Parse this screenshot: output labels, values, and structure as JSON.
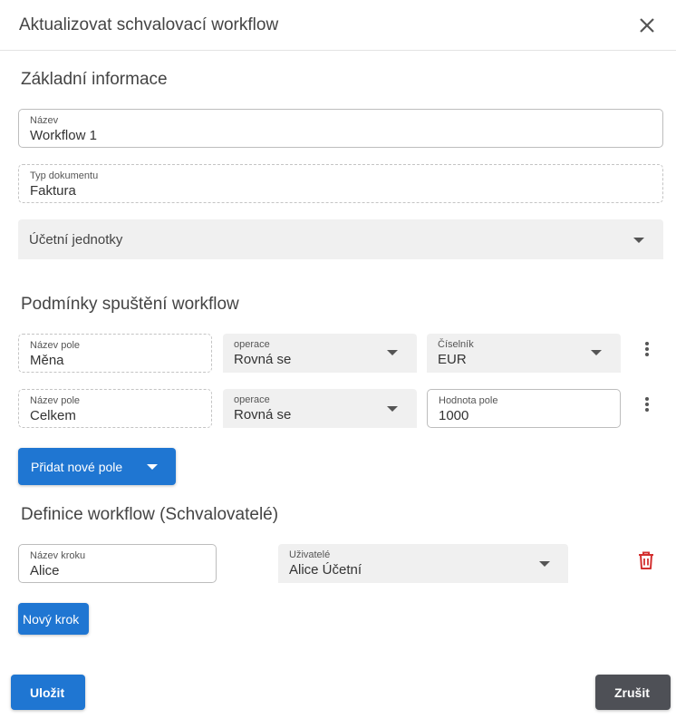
{
  "dialog": {
    "title": "Aktualizovat schvalovací workflow"
  },
  "basic_info": {
    "heading": "Základní informace",
    "name_label": "Název",
    "name_value": "Workflow 1",
    "doc_type_label": "Typ dokumentu",
    "doc_type_value": "Faktura",
    "units_placeholder": "Účetní jednotky"
  },
  "conditions": {
    "heading": "Podmínky spuštění workflow",
    "rows": [
      {
        "field_label": "Název pole",
        "field_value": "Měna",
        "op_label": "operace",
        "op_value": "Rovná se",
        "third_label": "Číselník",
        "third_value": "EUR"
      },
      {
        "field_label": "Název pole",
        "field_value": "Celkem",
        "op_label": "operace",
        "op_value": "Rovná se",
        "third_label": "Hodnota pole",
        "third_value": "1000"
      }
    ],
    "add_field_label": "Přidat nové pole"
  },
  "definition": {
    "heading": "Definice workflow (Schvalovatelé)",
    "steps": [
      {
        "step_label": "Název kroku",
        "step_value": "Alice",
        "users_label": "Uživatelé",
        "users_value": "Alice Účetní"
      }
    ],
    "new_step_label": "Nový krok"
  },
  "footer": {
    "save_label": "Uložit",
    "cancel_label": "Zrušit"
  },
  "colors": {
    "primary": "#1f76d2",
    "cancel": "#4e5056",
    "delete": "#d32f2f"
  },
  "icons": {
    "close": "close-icon",
    "dropdown": "caret-down-icon",
    "more": "more-vertical-icon",
    "delete": "trash-icon"
  }
}
